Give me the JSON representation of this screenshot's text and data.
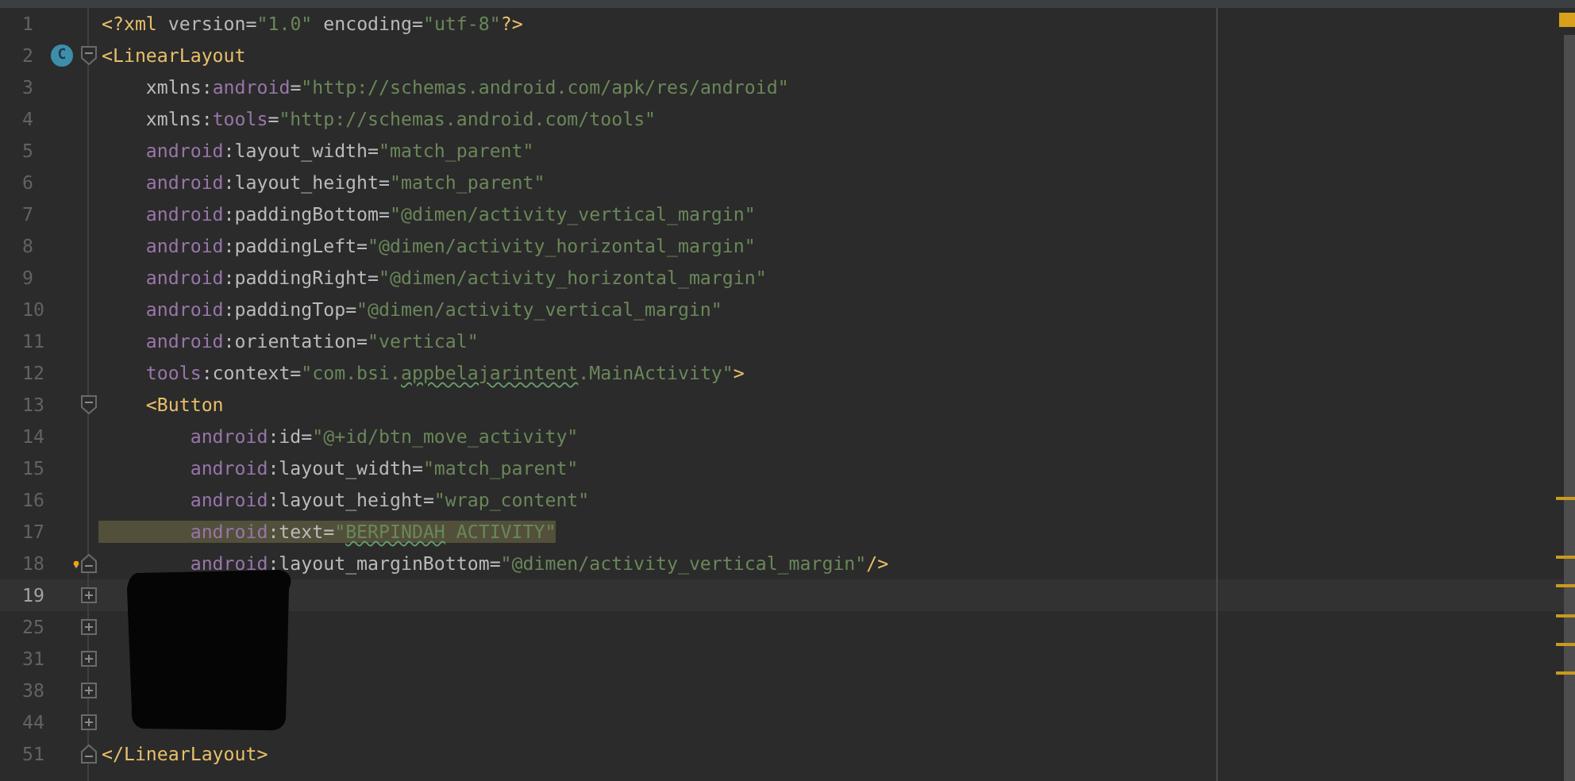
{
  "editor": {
    "lines": [
      {
        "number": "1",
        "tokens": [
          {
            "kind": "tag",
            "text": "<?xml "
          },
          {
            "kind": "attr",
            "text": "version"
          },
          {
            "kind": "punct",
            "text": "="
          },
          {
            "kind": "value",
            "text": "\"1.0\""
          },
          {
            "kind": "attr",
            "text": " encoding"
          },
          {
            "kind": "punct",
            "text": "="
          },
          {
            "kind": "value",
            "text": "\"utf-8\""
          },
          {
            "kind": "tag",
            "text": "?>"
          }
        ]
      },
      {
        "number": "2",
        "fold": {
          "kind": "start"
        },
        "badge": "C",
        "tokens": [
          {
            "kind": "tag",
            "text": "<LinearLayout"
          }
        ]
      },
      {
        "number": "3",
        "tokens": [
          {
            "kind": "attr",
            "text": "    xmlns:"
          },
          {
            "kind": "ns",
            "text": "android"
          },
          {
            "kind": "punct",
            "text": "="
          },
          {
            "kind": "value",
            "text": "\"http://schemas.android.com/apk/res/android\""
          }
        ]
      },
      {
        "number": "4",
        "tokens": [
          {
            "kind": "attr",
            "text": "    xmlns:"
          },
          {
            "kind": "ns",
            "text": "tools"
          },
          {
            "kind": "punct",
            "text": "="
          },
          {
            "kind": "value",
            "text": "\"http://schemas.android.com/tools\""
          }
        ]
      },
      {
        "number": "5",
        "tokens": [
          {
            "kind": "ns",
            "text": "    android"
          },
          {
            "kind": "attr",
            "text": ":layout_width"
          },
          {
            "kind": "punct",
            "text": "="
          },
          {
            "kind": "value",
            "text": "\"match_parent\""
          }
        ]
      },
      {
        "number": "6",
        "tokens": [
          {
            "kind": "ns",
            "text": "    android"
          },
          {
            "kind": "attr",
            "text": ":layout_height"
          },
          {
            "kind": "punct",
            "text": "="
          },
          {
            "kind": "value",
            "text": "\"match_parent\""
          }
        ]
      },
      {
        "number": "7",
        "tokens": [
          {
            "kind": "ns",
            "text": "    android"
          },
          {
            "kind": "attr",
            "text": ":paddingBottom"
          },
          {
            "kind": "punct",
            "text": "="
          },
          {
            "kind": "value",
            "text": "\"@dimen/activity_vertical_margin\""
          }
        ]
      },
      {
        "number": "8",
        "tokens": [
          {
            "kind": "ns",
            "text": "    android"
          },
          {
            "kind": "attr",
            "text": ":paddingLeft"
          },
          {
            "kind": "punct",
            "text": "="
          },
          {
            "kind": "value",
            "text": "\"@dimen/activity_horizontal_margin\""
          }
        ]
      },
      {
        "number": "9",
        "tokens": [
          {
            "kind": "ns",
            "text": "    android"
          },
          {
            "kind": "attr",
            "text": ":paddingRight"
          },
          {
            "kind": "punct",
            "text": "="
          },
          {
            "kind": "value",
            "text": "\"@dimen/activity_horizontal_margin\""
          }
        ]
      },
      {
        "number": "10",
        "tokens": [
          {
            "kind": "ns",
            "text": "    android"
          },
          {
            "kind": "attr",
            "text": ":paddingTop"
          },
          {
            "kind": "punct",
            "text": "="
          },
          {
            "kind": "value",
            "text": "\"@dimen/activity_vertical_margin\""
          }
        ]
      },
      {
        "number": "11",
        "tokens": [
          {
            "kind": "ns",
            "text": "    android"
          },
          {
            "kind": "attr",
            "text": ":orientation"
          },
          {
            "kind": "punct",
            "text": "="
          },
          {
            "kind": "value",
            "text": "\"vertical\""
          }
        ]
      },
      {
        "number": "12",
        "tokens": [
          {
            "kind": "ns",
            "text": "    tools"
          },
          {
            "kind": "attr",
            "text": ":context"
          },
          {
            "kind": "punct",
            "text": "="
          },
          {
            "kind": "value",
            "text": "\"com.bsi."
          },
          {
            "kind": "typo",
            "text": "appbelajarintent"
          },
          {
            "kind": "value",
            "text": ".MainActivity\""
          },
          {
            "kind": "tag",
            "text": ">"
          }
        ]
      },
      {
        "number": "13",
        "fold": {
          "kind": "start"
        },
        "tokens": [
          {
            "kind": "tag",
            "text": "    <Button"
          }
        ]
      },
      {
        "number": "14",
        "tokens": [
          {
            "kind": "ns",
            "text": "        android"
          },
          {
            "kind": "attr",
            "text": ":id"
          },
          {
            "kind": "punct",
            "text": "="
          },
          {
            "kind": "value",
            "text": "\"@+id/btn_move_activity\""
          }
        ]
      },
      {
        "number": "15",
        "tokens": [
          {
            "kind": "ns",
            "text": "        android"
          },
          {
            "kind": "attr",
            "text": ":layout_width"
          },
          {
            "kind": "punct",
            "text": "="
          },
          {
            "kind": "value",
            "text": "\"match_parent\""
          }
        ]
      },
      {
        "number": "16",
        "tokens": [
          {
            "kind": "ns",
            "text": "        android"
          },
          {
            "kind": "attr",
            "text": ":layout_height"
          },
          {
            "kind": "punct",
            "text": "="
          },
          {
            "kind": "value",
            "text": "\"wrap_content\""
          }
        ]
      },
      {
        "number": "17",
        "highlighted": true,
        "tokens": [
          {
            "kind": "ns",
            "text": "        android"
          },
          {
            "kind": "attr",
            "text": ":text"
          },
          {
            "kind": "punct",
            "text": "="
          },
          {
            "kind": "value",
            "text": "\""
          },
          {
            "kind": "typo",
            "text": "BERPINDAH"
          },
          {
            "kind": "value",
            "text": " ACTIVITY\""
          }
        ]
      },
      {
        "number": "18",
        "fold": {
          "kind": "end"
        },
        "hint": true,
        "tokens": [
          {
            "kind": "ns",
            "text": "        android"
          },
          {
            "kind": "attr",
            "text": ":layout_marginBottom"
          },
          {
            "kind": "punct",
            "text": "="
          },
          {
            "kind": "value",
            "text": "\"@dimen/activity_vertical_margin\""
          },
          {
            "kind": "tag",
            "text": "/>"
          }
        ]
      },
      {
        "number": "19",
        "fold": {
          "kind": "collapsed"
        },
        "current": true
      },
      {
        "number": "25",
        "fold": {
          "kind": "collapsed"
        }
      },
      {
        "number": "31",
        "fold": {
          "kind": "collapsed"
        }
      },
      {
        "number": "38",
        "fold": {
          "kind": "collapsed"
        }
      },
      {
        "number": "44",
        "fold": {
          "kind": "collapsed"
        }
      },
      {
        "number": "51",
        "fold": {
          "kind": "end"
        },
        "tokens": [
          {
            "kind": "tag",
            "text": "</LinearLayout>"
          }
        ]
      }
    ]
  }
}
